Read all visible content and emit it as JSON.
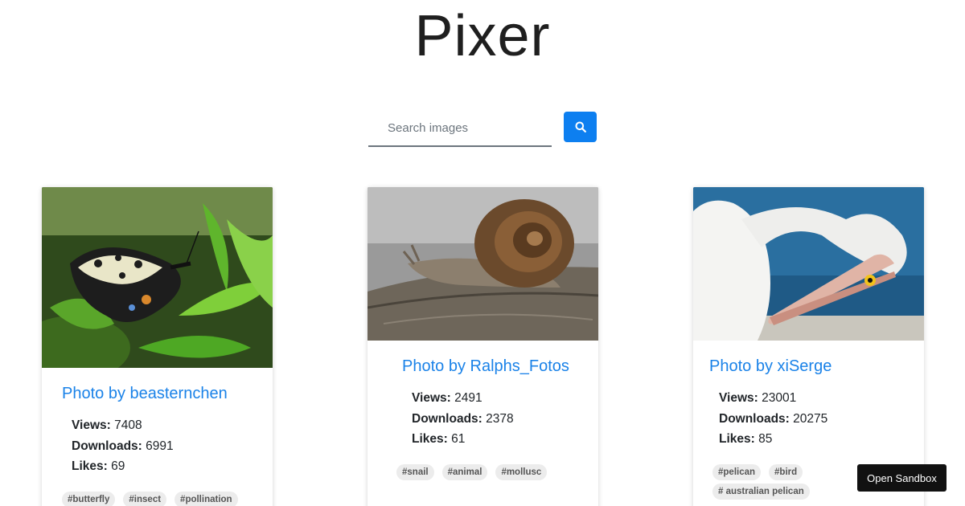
{
  "app": {
    "title": "Pixer"
  },
  "search": {
    "placeholder": "Search images",
    "value": "",
    "button_icon": "search-icon",
    "accent": "#0d7ff0"
  },
  "cards": [
    {
      "author": "Photo by beasternchen",
      "image_subject": "butterfly on green leaves",
      "stats": [
        {
          "label": "Views:",
          "value": "7408"
        },
        {
          "label": "Downloads:",
          "value": "6991"
        },
        {
          "label": "Likes:",
          "value": "69"
        }
      ],
      "tags": [
        "#butterfly",
        "#insect",
        "#pollination"
      ]
    },
    {
      "author": "Photo by Ralphs_Fotos",
      "image_subject": "snail on bark",
      "stats": [
        {
          "label": "Views:",
          "value": "2491"
        },
        {
          "label": "Downloads:",
          "value": "2378"
        },
        {
          "label": "Likes:",
          "value": "61"
        }
      ],
      "tags": [
        "#snail",
        "#animal",
        "#mollusc"
      ]
    },
    {
      "author": "Photo by xiSerge",
      "image_subject": "pelican preening by the sea",
      "stats": [
        {
          "label": "Views:",
          "value": "23001"
        },
        {
          "label": "Downloads:",
          "value": "20275"
        },
        {
          "label": "Likes:",
          "value": "85"
        }
      ],
      "tags": [
        "#pelican",
        "#bird",
        "# australian pelican"
      ]
    }
  ],
  "sandbox": {
    "label": "Open Sandbox"
  }
}
